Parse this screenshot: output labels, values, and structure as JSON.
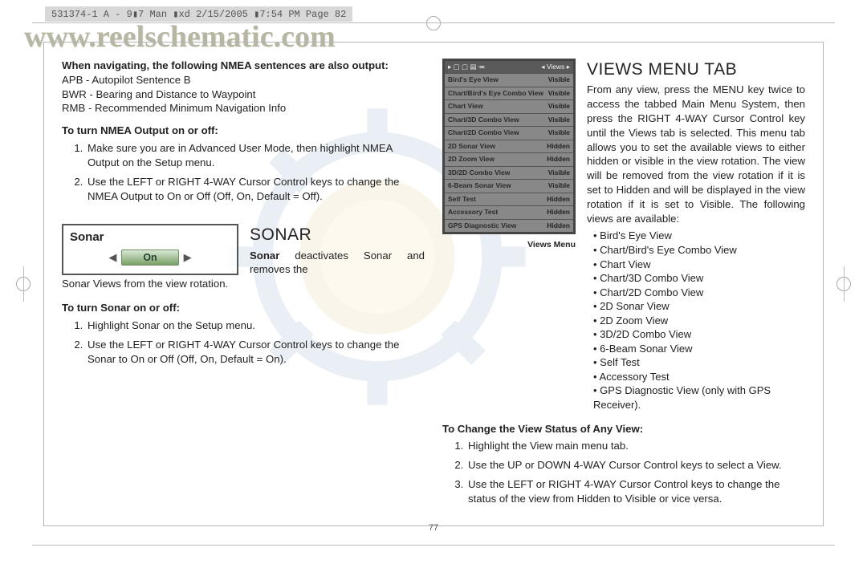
{
  "header_bar": "531374-1 A - 9▮7 Man ▮xd  2/15/2005 ▮7:54 PM  Page 82",
  "watermark": "www.reelschematic.com",
  "page_number": "77",
  "left": {
    "nmea_heading": "When navigating, the following NMEA sentences are also output:",
    "nmea_lines": {
      "l1": "APB - Autopilot Sentence B",
      "l2": "BWR - Bearing and Distance to Waypoint",
      "l3": "RMB - Recommended Minimum Navigation Info"
    },
    "turn_nmea_head": "To turn NMEA Output on or off:",
    "turn_nmea_1": "Make sure you are in Advanced User Mode, then highlight NMEA Output on the Setup menu.",
    "turn_nmea_2": "Use the LEFT or RIGHT 4-WAY Cursor Control keys to change the NMEA Output to On or Off (Off, On, Default = Off).",
    "sonar_box": {
      "title": "Sonar",
      "value": "On"
    },
    "sonar_title": "SONAR",
    "sonar_run_bold": "Sonar",
    "sonar_run": " deactivates Sonar and removes the",
    "sonar_cont": "Sonar Views from the view rotation.",
    "turn_sonar_head": "To turn Sonar on or off:",
    "turn_sonar_1": "Highlight Sonar on the Setup menu.",
    "turn_sonar_2": "Use the LEFT or RIGHT 4-WAY Cursor Control keys to change the Sonar to On or Off (Off, On, Default = On)."
  },
  "right": {
    "views_title": "VIEWS MENU TAB",
    "views_para": "From any view, press the MENU key twice to access the tabbed Main Menu System, then press the RIGHT 4-WAY Cursor Control key until the Views tab is selected. This menu tab allows you to set the available views to either hidden or visible in the view rotation. The view will be removed from the view rotation if it is set to Hidden and will be displayed in the view rotation if it is set to Visible. The following views are available:",
    "bullets": {
      "b1": "Bird's Eye View",
      "b2": "Chart/Bird's Eye Combo View",
      "b3": "Chart View",
      "b4": "Chart/3D Combo View",
      "b5": "Chart/2D Combo View",
      "b6": "2D Sonar View",
      "b7": "2D Zoom View",
      "b8": "3D/2D Combo View",
      "b9": "6-Beam Sonar View",
      "b10": "Self Test",
      "b11": "Accessory Test",
      "b12": "GPS Diagnostic View (only with GPS Receiver)."
    },
    "screenshot_caption": "Views Menu",
    "screenshot_header_left": "▸ ▢ ▢ ▤ ≔",
    "screenshot_header_right": "◂ Views ▸",
    "rows": [
      {
        "name": "Bird's Eye View",
        "state": "Visible"
      },
      {
        "name": "Chart/Bird's Eye Combo View",
        "state": "Visible"
      },
      {
        "name": "Chart View",
        "state": "Visible"
      },
      {
        "name": "Chart/3D Combo View",
        "state": "Visible"
      },
      {
        "name": "Chart/2D Combo View",
        "state": "Visible"
      },
      {
        "name": "2D Sonar View",
        "state": "Hidden"
      },
      {
        "name": "2D Zoom View",
        "state": "Hidden"
      },
      {
        "name": "3D/2D Combo View",
        "state": "Visible"
      },
      {
        "name": "6-Beam Sonar View",
        "state": "Visible"
      },
      {
        "name": "Self Test",
        "state": "Hidden"
      },
      {
        "name": "Accessory Test",
        "state": "Hidden"
      },
      {
        "name": "GPS Diagnostic View",
        "state": "Hidden"
      }
    ],
    "change_head": "To Change the View Status of Any View:",
    "change_1": "Highlight the View main menu tab.",
    "change_2": "Use the UP or DOWN 4-WAY Cursor Control keys to select a View.",
    "change_3": "Use the LEFT or RIGHT 4-WAY Cursor Control keys to change the status of the view from Hidden to Visible or vice versa."
  }
}
